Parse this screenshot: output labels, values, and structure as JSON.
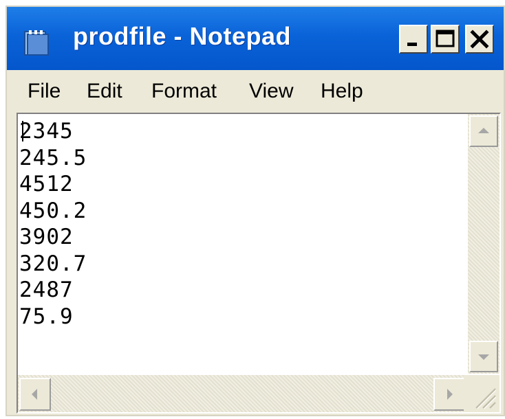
{
  "window": {
    "title": "prodfile - Notepad",
    "icon": "notepad-icon"
  },
  "title_controls": {
    "minimize_icon": "minimize-icon",
    "maximize_icon": "maximize-icon",
    "close_icon": "close-icon"
  },
  "menu": {
    "file": "File",
    "edit": "Edit",
    "format": "Format",
    "view": "View",
    "help": "Help"
  },
  "document": {
    "lines": [
      "2345",
      "245.5",
      "4512",
      "450.2",
      "3902",
      "320.7",
      "2487",
      "75.9"
    ]
  },
  "colors": {
    "titlebar": "#0a63d8",
    "chrome": "#ece9d8",
    "editor_bg": "#ffffff",
    "close_x": "#000000"
  }
}
